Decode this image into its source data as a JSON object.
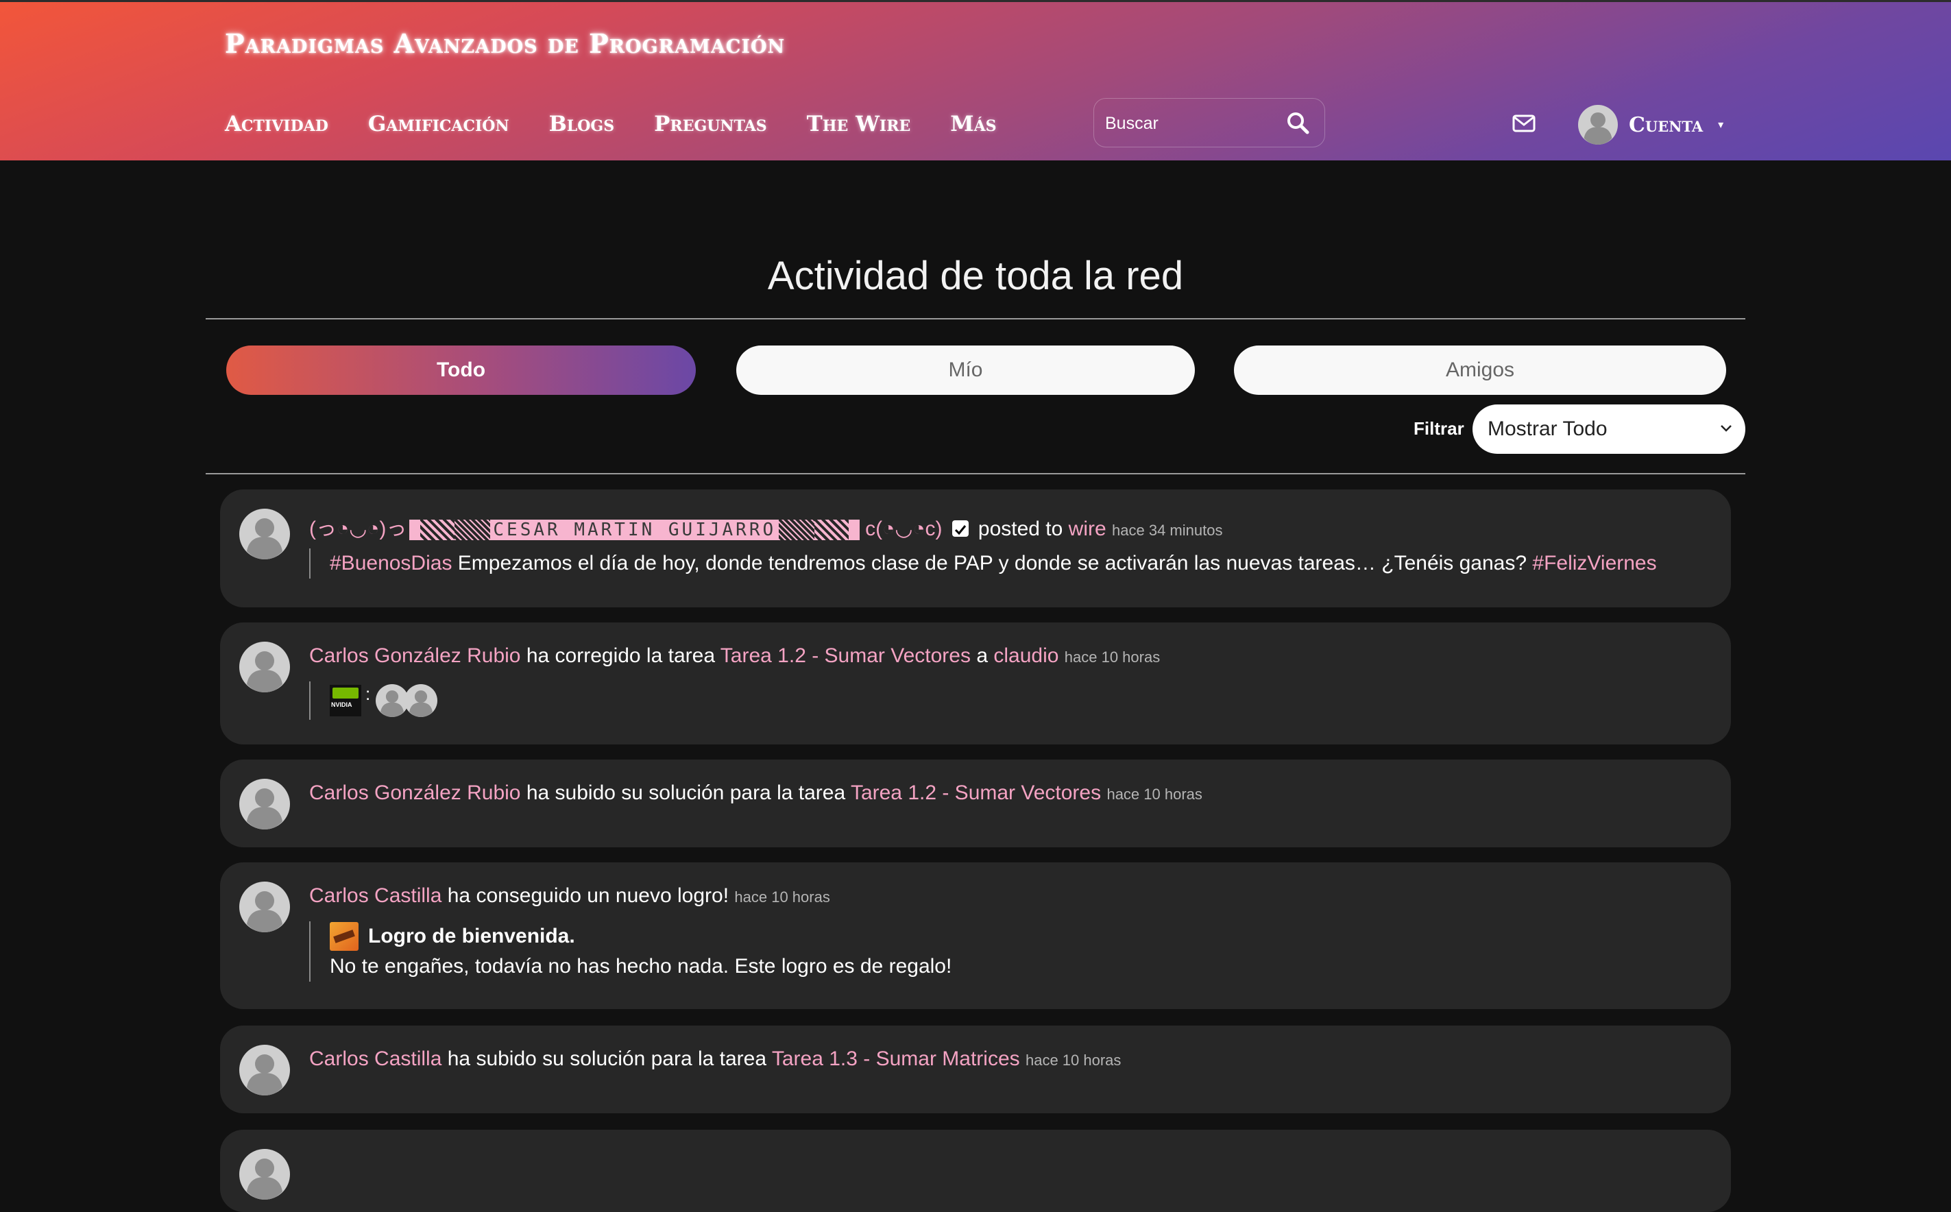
{
  "header": {
    "site_title": "Paradigmas Avanzados de Programación",
    "nav": [
      "Actividad",
      "Gamificación",
      "Blogs",
      "Preguntas",
      "The Wire",
      "Más"
    ],
    "search_placeholder": "Buscar",
    "account_label": "Cuenta",
    "icons": [
      "search-icon",
      "mail-icon",
      "avatar",
      "caret-down-icon"
    ]
  },
  "main": {
    "title": "Actividad de toda la red",
    "tabs": [
      {
        "label": "Todo",
        "active": true
      },
      {
        "label": "Mío",
        "active": false
      },
      {
        "label": "Amigos",
        "active": false
      }
    ],
    "filter_label": "Filtrar",
    "filter_value": "Mostrar Todo"
  },
  "activities": [
    {
      "user_prefix": "(っ◔◡◔)っ",
      "user_name": "CESAR MARTIN GUIJARRO",
      "user_suffix": "c(◔◡◔c)",
      "verb": "posted to",
      "target": "wire",
      "time": "hace 34 minutos",
      "hashtag1": "#BuenosDias",
      "body": "Empezamos el día de hoy, donde tendremos clase de PAP y donde se activarán las nuevas tareas… ¿Tenéis ganas?",
      "hashtag2": "#FelizViernes"
    },
    {
      "user": "Carlos González Rubio",
      "verb": "ha corregido la tarea",
      "target": "Tarea 1.2 - Sumar Vectores",
      "connector": "a",
      "recipient": "claudio",
      "time": "hace 10 horas",
      "badge_text": "NVIDIA",
      "colon": ":"
    },
    {
      "user": "Carlos González Rubio",
      "verb": "ha subido su solución para la tarea",
      "target": "Tarea 1.2 - Sumar Vectores",
      "time": "hace 10 horas"
    },
    {
      "user": "Carlos Castilla",
      "verb": "ha conseguido un nuevo logro!",
      "time": "hace 10 horas",
      "achievement_title": "Logro de bienvenida.",
      "achievement_desc": "No te engañes, todavía no has hecho nada. Este logro es de regalo!"
    },
    {
      "user": "Carlos Castilla",
      "verb": "ha subido su solución para la tarea",
      "target": "Tarea 1.3 - Sumar Matrices",
      "time": "hace 10 horas"
    }
  ],
  "colors": {
    "link": "#f4a3c3",
    "card_bg": "#272727",
    "page_bg": "#111111",
    "header_gradient_start": "#f2563a",
    "header_gradient_end": "#5a47b0"
  }
}
